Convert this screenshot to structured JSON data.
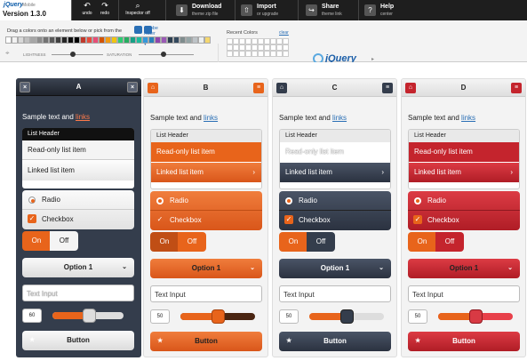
{
  "app": {
    "logo_text": "jQuery",
    "logo_sub": "Mobile",
    "version": "Version 1.3.0"
  },
  "toolbar": {
    "undo_label": "undo",
    "redo_label": "redo",
    "inspector_label": "Inspector off",
    "download_title": "Download",
    "download_sub": "theme zip file",
    "import_title": "Import",
    "import_sub": "or upgrade",
    "share_title": "Share",
    "share_sub": "theme link",
    "help_title": "Help",
    "help_sub": "center"
  },
  "colorbar": {
    "drag_text": "Drag a colors onto an element below or pick from the",
    "kuler_link": "Adobe Kuler swatches ▾",
    "lightness_label": "LIGHTNESS",
    "saturation_label": "SATURATION",
    "recent_label": "Recent Colors",
    "clear_label": "clear",
    "arrow": "▸",
    "swatches": [
      "#ffffff",
      "#f2f2f2",
      "#d9d9d9",
      "#bfbfbf",
      "#a6a6a6",
      "#8c8c8c",
      "#737373",
      "#595959",
      "#404040",
      "#262626",
      "#0d0d0d",
      "#000000",
      "#c0392b",
      "#e74c3c",
      "#e94e77",
      "#d35400",
      "#f39c12",
      "#f1c40f",
      "#2ecc71",
      "#27ae60",
      "#16a085",
      "#1abc9c",
      "#3498db",
      "#2980b9",
      "#8e44ad",
      "#9b59b6",
      "#2c3e50",
      "#34495e",
      "#7f8c8d",
      "#95a5a6",
      "#bdc3c7",
      "#ecf0f1",
      "#f5d76e"
    ]
  },
  "swatches_ui": {
    "a": {
      "title": "A",
      "sample": "Sample text and ",
      "link": "links",
      "list_header": "List Header",
      "readonly": "Read-only list item",
      "linked": "Linked list item",
      "radio": "Radio",
      "checkbox": "Checkbox",
      "on": "On",
      "off": "Off",
      "select": "Option 1",
      "input": "Text Input",
      "slider_value": "60",
      "button": "Button"
    },
    "b": {
      "title": "B",
      "sample": "Sample text and ",
      "link": "links",
      "list_header": "List Header",
      "readonly": "Read-only list item",
      "linked": "Linked list item",
      "radio": "Radio",
      "checkbox": "Checkbox",
      "on": "On",
      "off": "Off",
      "select": "Option 1",
      "input": "Text Input",
      "slider_value": "50",
      "button": "Button"
    },
    "c": {
      "title": "C",
      "sample": "Sample text and ",
      "link": "links",
      "list_header": "List Header",
      "readonly": "Read-only list item",
      "linked": "Linked list item",
      "radio": "Radio",
      "checkbox": "Checkbox",
      "on": "On",
      "off": "Off",
      "select": "Option 1",
      "input": "Text Input",
      "slider_value": "50",
      "button": "Button"
    },
    "d": {
      "title": "D",
      "sample": "Sample text and ",
      "link": "links",
      "list_header": "List Header",
      "readonly": "Read-only list item",
      "linked": "Linked list item",
      "radio": "Radio",
      "checkbox": "Checkbox",
      "on": "On",
      "off": "Off",
      "select": "Option 1",
      "input": "Text Input",
      "slider_value": "50",
      "button": "Button"
    }
  },
  "icons": {
    "undo": "↶",
    "redo": "↷",
    "inspector": "⌕",
    "download": "⬇",
    "import": "⇧",
    "share": "↪",
    "help": "?",
    "close": "×",
    "home": "⌂",
    "menu": "≡",
    "chevron": "›",
    "down": "⌄",
    "star": "★",
    "check": "✓"
  },
  "colors": {
    "accent_orange": "#e8641b",
    "accent_dark": "#343d4c",
    "accent_red": "#c4242d",
    "link_blue": "#2a6fb5"
  }
}
